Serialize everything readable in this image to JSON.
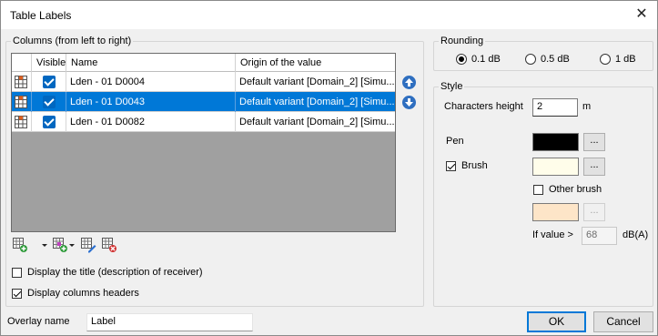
{
  "window": {
    "title": "Table Labels"
  },
  "columns_group": {
    "label": "Columns (from left to right)",
    "headers": [
      "Visible",
      "Name",
      "Origin of the value"
    ],
    "rows": [
      {
        "visible": true,
        "name": "Lden - 01 D0004",
        "origin": "Default variant [Domain_2] [Simu..."
      },
      {
        "visible": true,
        "name": "Lden - 01 D0043",
        "origin": "Default variant [Domain_2] [Simu..."
      },
      {
        "visible": true,
        "name": "Lden - 01 D0082",
        "origin": "Default variant [Domain_2] [Simu..."
      }
    ],
    "selected_row": 1,
    "display_title_label": "Display the title (description of receiver)",
    "display_title_checked": false,
    "display_headers_label": "Display columns headers",
    "display_headers_checked": true
  },
  "rounding": {
    "label": "Rounding",
    "options": [
      "0.1 dB",
      "0.5 dB",
      "1 dB"
    ],
    "selected": "0.1 dB"
  },
  "style": {
    "label": "Style",
    "char_height_label": "Characters height",
    "char_height_value": "2",
    "char_height_unit": "m",
    "pen_label": "Pen",
    "pen_color": "#000000",
    "brush_label": "Brush",
    "brush_checked": true,
    "brush_color": "#fffdea",
    "other_brush_label": "Other brush",
    "other_brush_checked": false,
    "other_brush_color": "#fde5c8",
    "if_value_label": "If value >",
    "if_value": "68",
    "if_value_unit": "dB(A)",
    "dots": "..."
  },
  "overlay": {
    "label": "Overlay name",
    "value": "Label"
  },
  "buttons": {
    "ok": "OK",
    "cancel": "Cancel"
  },
  "close_glyph": "✕"
}
